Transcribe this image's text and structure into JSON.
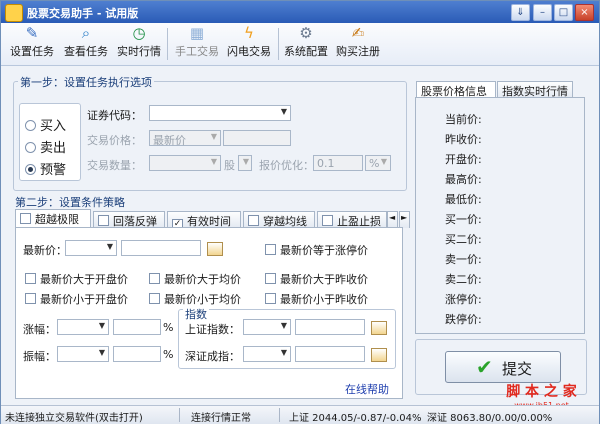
{
  "window": {
    "title": "股票交易助手 - 试用版",
    "controls": {
      "minimize": "–",
      "maximize": "□",
      "close": "×",
      "extra": "⇓"
    }
  },
  "toolbar": {
    "set_task": "设置任务",
    "view_task": "查看任务",
    "realtime": "实时行情",
    "manual_trade": "手工交易",
    "flash_trade": "闪电交易",
    "system_config": "系统配置",
    "buy_register": "购买注册"
  },
  "step1": {
    "title": "第一步：设置任务执行选项",
    "radio": {
      "buy": "买入",
      "sell": "卖出",
      "alert": "预警",
      "selected": "alert"
    },
    "code_label": "证券代码：",
    "code_value": "",
    "price_label": "交易价格：",
    "price_mode": "最新价",
    "qty_label": "交易数量：",
    "qty_unit": "股",
    "optimize_label": "报价优化：",
    "optimize_value": "0.1",
    "optimize_unit": "%"
  },
  "step2": {
    "title": "第二步：设置条件策略",
    "tabs": [
      {
        "label": "超越极限",
        "checked": false
      },
      {
        "label": "回落反弹",
        "checked": false
      },
      {
        "label": "有效时间",
        "checked": true
      },
      {
        "label": "穿越均线",
        "checked": false
      },
      {
        "label": "止盈止损",
        "checked": false
      }
    ],
    "scroll_left": "◄",
    "scroll_right": "►",
    "latest_price_label": "最新价：",
    "eq_limit_up": "最新价等于涨停价",
    "gt_open": "最新价大于开盘价",
    "gt_avg": "最新价大于均价",
    "gt_prev_close": "最新价大于昨收价",
    "lt_open": "最新价小于开盘价",
    "lt_avg": "最新价小于均价",
    "lt_prev_close": "最新价小于昨收价",
    "rise_label": "涨幅：",
    "amplitude_label": "振幅：",
    "percent": "%",
    "index_title": "指数",
    "sh_index_label": "上证指数：",
    "sz_index_label": "深证成指：",
    "help_link": "在线帮助"
  },
  "right_panel": {
    "tabs": [
      "股票价格信息",
      "指数实时行情"
    ],
    "rows": [
      "当前价:",
      "昨收价:",
      "开盘价:",
      "最高价:",
      "最低价:",
      "买一价:",
      "买二价:",
      "卖一价:",
      "卖二价:",
      "涨停价:",
      "跌停价:"
    ]
  },
  "submit": {
    "label": "提交"
  },
  "watermark": {
    "line1": "脚 本 之 家",
    "line2": "www.jb51.net"
  },
  "status": {
    "connection": "未连接独立交易软件(双击打开)",
    "quote": "连接行情正常",
    "sh": "上证 2044.05/-0.87/-0.04%",
    "sz": "深证 8063.80/0.00/0.00%"
  }
}
